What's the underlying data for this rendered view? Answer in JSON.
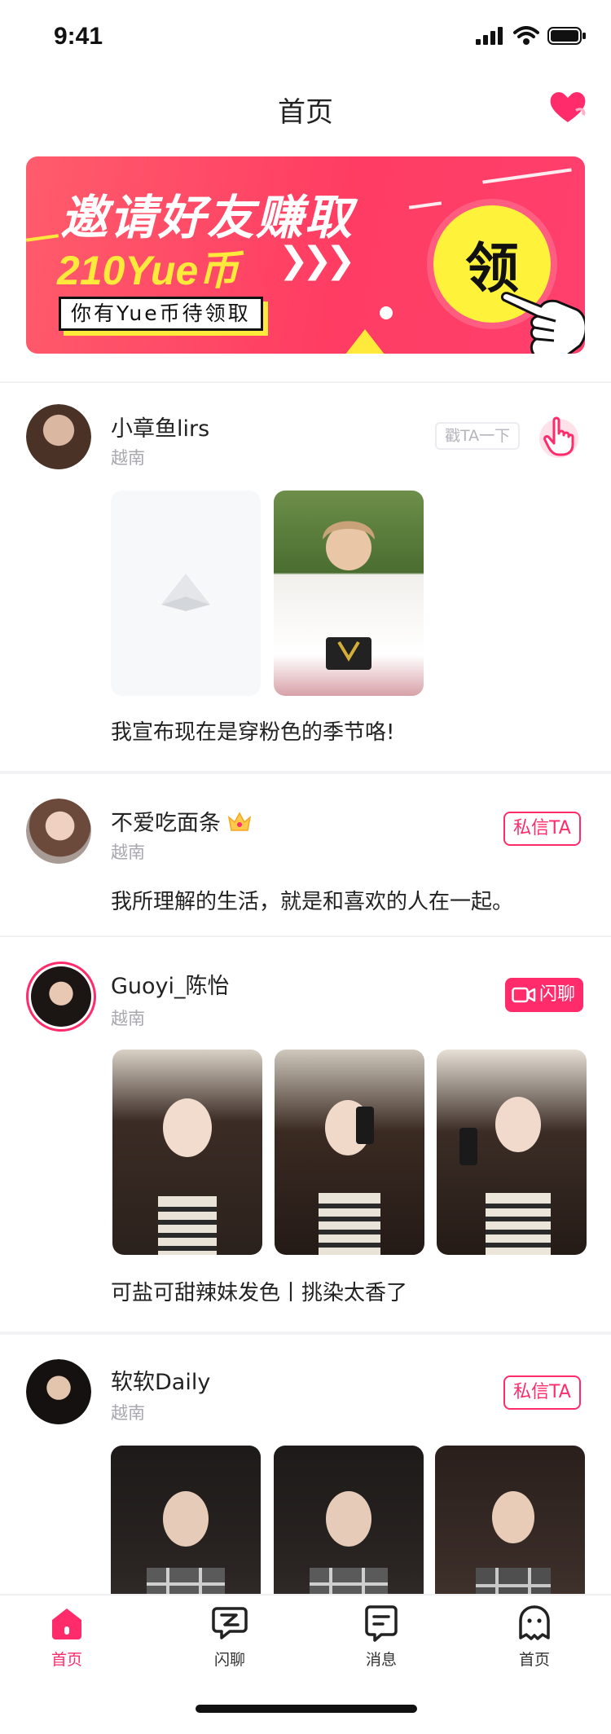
{
  "status_bar": {
    "time": "9:41"
  },
  "header": {
    "title": "首页",
    "heart_icon": "heart-message-icon"
  },
  "banner": {
    "line1": "邀请好友赚取",
    "line2": "210Yue币",
    "arrows": "❯❯❯",
    "tag": "你有Yue币待领取",
    "claim": "领",
    "accent_color": "#ff3d63",
    "highlight_color": "#fff23a"
  },
  "posts": [
    {
      "username": "小章鱼lirs",
      "location": "越南",
      "action": "戳TA一下",
      "action_icon": "poke-hand-icon",
      "caption": "我宣布现在是穿粉色的季节咯!"
    },
    {
      "username": "不爱吃面条",
      "badge_icon": "crown-icon",
      "location": "越南",
      "action": "私信TA",
      "caption": "我所理解的生活，就是和喜欢的人在一起。"
    },
    {
      "username": "Guoyi_陈怡",
      "location": "越南",
      "action": "闪聊",
      "action_icon": "video-camera-icon",
      "caption": "可盐可甜辣妹发色丨挑染太香了"
    },
    {
      "username": "软软Daily",
      "location": "越南",
      "action": "私信TA",
      "caption": ""
    }
  ],
  "tabbar": {
    "items": [
      {
        "label": "首页",
        "icon": "home-icon",
        "active": true
      },
      {
        "label": "闪聊",
        "icon": "flash-chat-icon",
        "active": false
      },
      {
        "label": "消息",
        "icon": "message-icon",
        "active": false
      },
      {
        "label": "首页",
        "icon": "profile-icon",
        "active": false
      }
    ],
    "active_color": "#ff2b6b"
  }
}
